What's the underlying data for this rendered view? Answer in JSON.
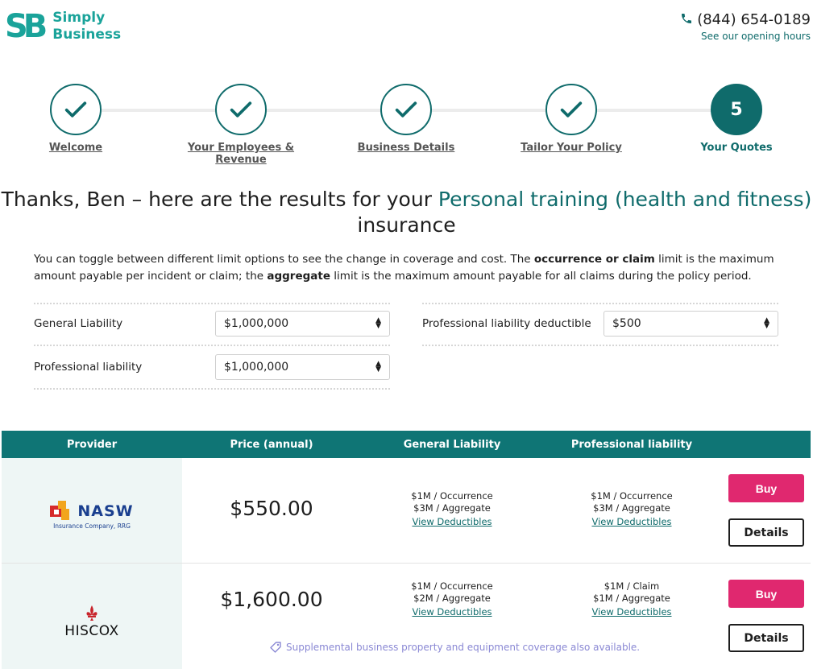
{
  "brand": {
    "logo_mark": "SB",
    "name_line1": "Simply",
    "name_line2": "Business"
  },
  "contact": {
    "phone": "(844) 654-0189",
    "hours_link": "See our opening hours"
  },
  "steps": [
    {
      "label": "Welcome",
      "state": "complete"
    },
    {
      "label": "Your Employees & Revenue",
      "state": "complete"
    },
    {
      "label": "Business Details",
      "state": "complete"
    },
    {
      "label": "Tailor Your Policy",
      "state": "complete"
    },
    {
      "label": "Your Quotes",
      "state": "current",
      "number": "5"
    }
  ],
  "headline": {
    "prefix": "Thanks, Ben – here are the results for your ",
    "highlight": "Personal training (health and fitness)",
    "suffix": "insurance"
  },
  "intro": {
    "part1": "You can toggle between different limit options to see the change in coverage and cost. The ",
    "bold1": "occurrence or claim",
    "part2": " limit is the maximum amount payable per incident or claim; the ",
    "bold2": "aggregate",
    "part3": " limit is the maximum amount payable for all claims during the policy period."
  },
  "limits": {
    "general_liability": {
      "label": "General Liability",
      "value": "$1,000,000"
    },
    "professional_liability": {
      "label": "Professional liability",
      "value": "$1,000,000"
    },
    "professional_deductible": {
      "label": "Professional liability deductible",
      "value": "$500"
    }
  },
  "table": {
    "headers": [
      "Provider",
      "Price (annual)",
      "General Liability",
      "Professional liability"
    ],
    "rows": [
      {
        "provider": {
          "name": "NASW",
          "subtitle": "Insurance Company, RRG"
        },
        "price": "$550.00",
        "general": {
          "line1": "$1M / Occurrence",
          "line2": "$3M / Aggregate",
          "link": "View Deductibles"
        },
        "professional": {
          "line1": "$1M / Occurrence",
          "line2": "$3M / Aggregate",
          "link": "View Deductibles"
        },
        "buy_label": "Buy",
        "details_label": "Details"
      },
      {
        "provider": {
          "name": "HISCOX"
        },
        "price": "$1,600.00",
        "general": {
          "line1": "$1M / Occurrence",
          "line2": "$2M / Aggregate",
          "link": "View Deductibles"
        },
        "professional": {
          "line1": "$1M / Claim",
          "line2": "$1M / Aggregate",
          "link": "View Deductibles"
        },
        "buy_label": "Buy",
        "details_label": "Details",
        "supplemental": "Supplemental business property and equipment coverage also available."
      }
    ]
  },
  "colors": {
    "brand_teal": "#1aa39a",
    "dark_teal": "#0f6b6b",
    "header_teal": "#0f7575",
    "buy_pink": "#e0286f"
  }
}
